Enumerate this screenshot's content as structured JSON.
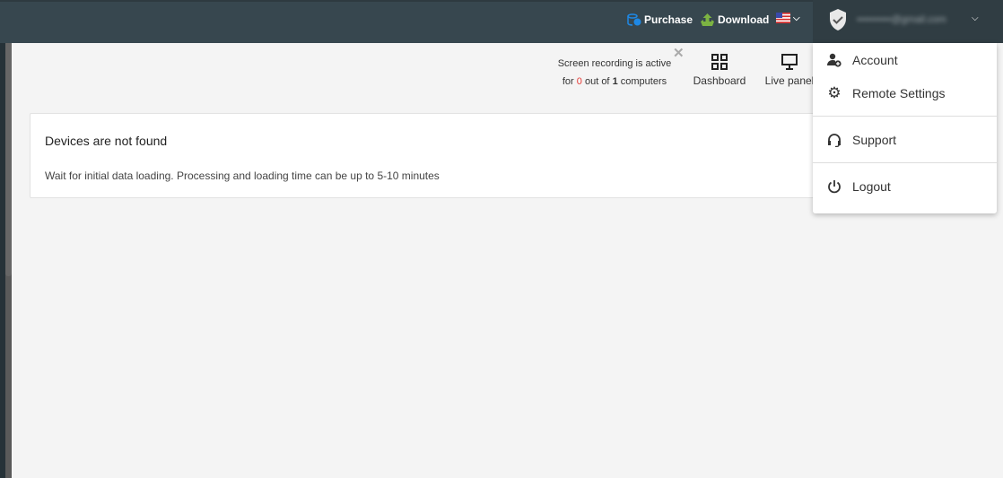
{
  "header": {
    "purchase": "Purchase",
    "download": "Download",
    "language_flag": "us-flag-icon",
    "user_email": "••••••••••@gmail.com"
  },
  "status": {
    "line1": "Screen recording is active",
    "prefix": "for",
    "active": "0",
    "middle": "out of",
    "total": "1",
    "suffix": "computers"
  },
  "nav": {
    "dashboard": "Dashboard",
    "live_panel": "Live panel"
  },
  "card": {
    "title": "Devices are not found",
    "message": "Wait for initial data loading. Processing and loading time can be up to 5-10 minutes"
  },
  "menu": {
    "items": [
      {
        "label": "Account",
        "icon": "account-add-icon"
      },
      {
        "label": "Remote Settings",
        "icon": "gear-icon"
      },
      {
        "label": "Support",
        "icon": "headset-icon"
      },
      {
        "label": "Logout",
        "icon": "power-icon"
      }
    ]
  },
  "colors": {
    "header": "#37474f",
    "purchase_icon": "#1e88e5",
    "download_icon": "#7cb342",
    "active_count": "#e53935"
  }
}
